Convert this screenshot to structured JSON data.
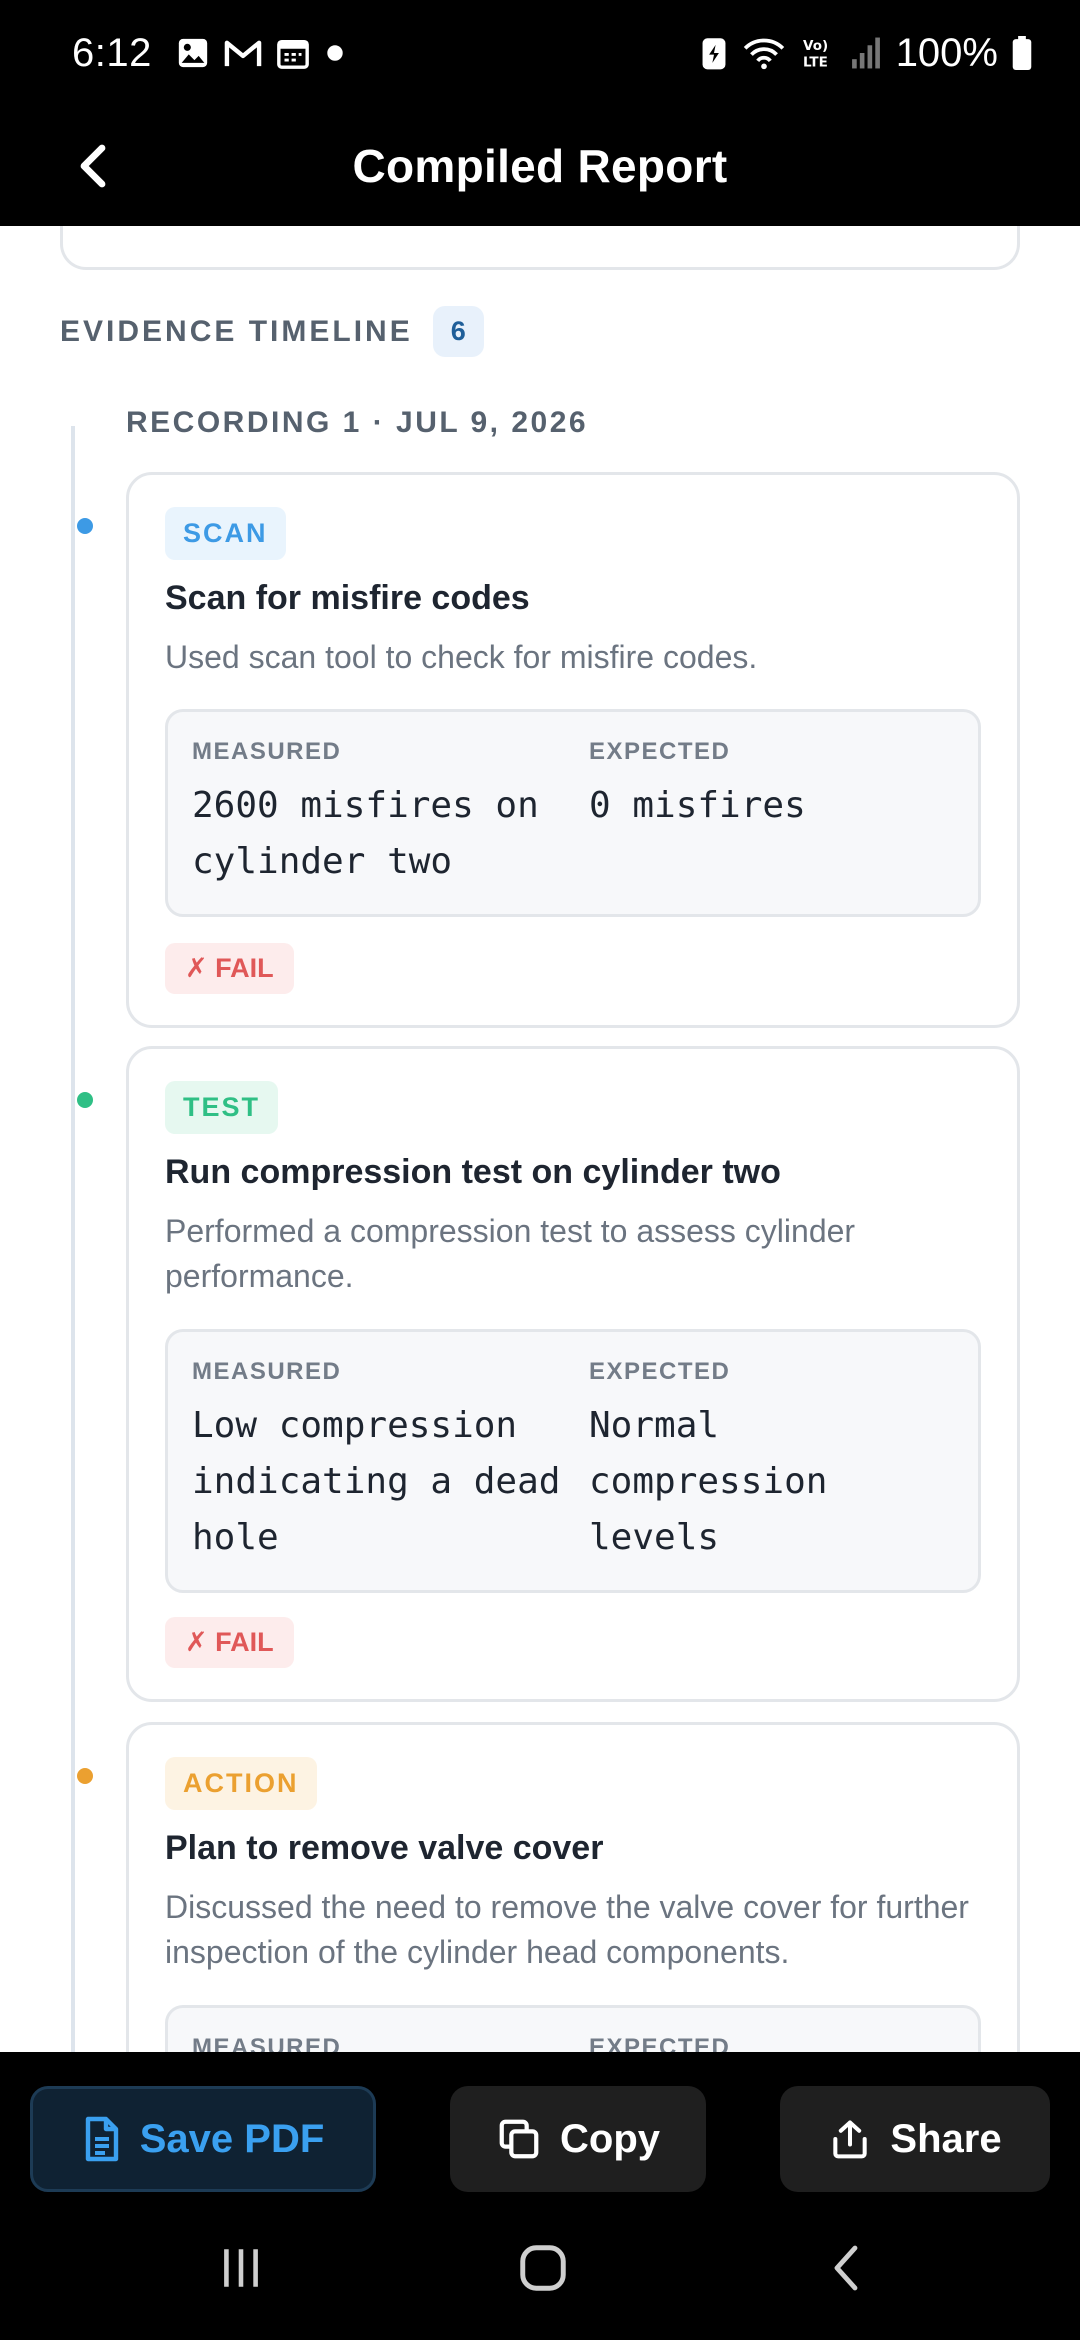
{
  "status_bar": {
    "time": "6:12",
    "battery": "100%",
    "icons": [
      "gallery-icon",
      "gmail-icon",
      "calendar-icon",
      "dot-icon",
      "battery-saver-icon",
      "wifi-icon",
      "volte-icon",
      "signal-icon",
      "battery-icon"
    ]
  },
  "header": {
    "title": "Compiled Report",
    "back_icon": "chevron-left-icon"
  },
  "timeline": {
    "title": "EVIDENCE TIMELINE",
    "count": "6",
    "recording_label": "RECORDING 1 · JUL 9, 2026",
    "measured_label": "MEASURED",
    "expected_label": "EXPECTED",
    "fail_label": "✗ FAIL",
    "entries": [
      {
        "tag": "SCAN",
        "title": "Scan for misfire codes",
        "description": "Used scan tool to check for misfire codes.",
        "measured": "2600 misfires on cylinder two",
        "expected": "0 misfires",
        "result": "FAIL",
        "color": "#3d9ae5"
      },
      {
        "tag": "TEST",
        "title": "Run compression test on cylinder two",
        "description": "Performed a compression test to assess cylinder performance.",
        "measured": "Low compression indicating a dead hole",
        "expected": "Normal compression levels",
        "result": "FAIL",
        "color": "#2fbf85"
      },
      {
        "tag": "ACTION",
        "title": "Plan to remove valve cover",
        "description": "Discussed the need to remove the valve cover for further inspection of the cylinder head components.",
        "color": "#eba030"
      }
    ]
  },
  "actions": {
    "save_pdf": "Save PDF",
    "copy": "Copy",
    "share": "Share"
  },
  "colors": {
    "accent": "#3aa0f0",
    "fail": "#e05858",
    "scan": "#3d9ae5",
    "test": "#2fbf85",
    "action": "#eba030"
  }
}
